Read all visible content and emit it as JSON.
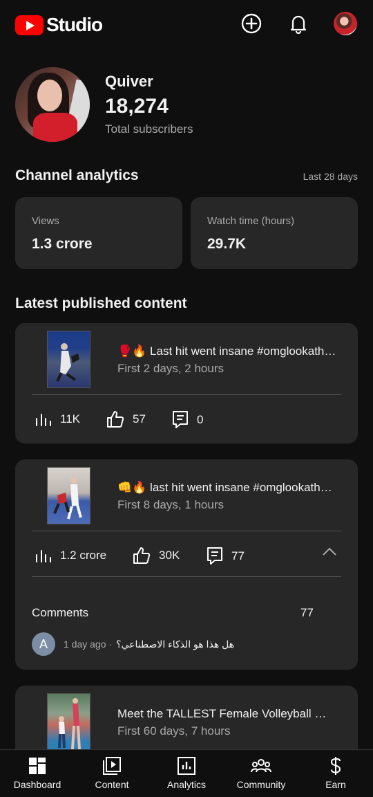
{
  "header": {
    "brand": "Studio",
    "icons": [
      "create-icon",
      "notifications-icon",
      "account-avatar"
    ]
  },
  "channel": {
    "name": "Quiver",
    "subscribers": "18,274",
    "subscribers_label": "Total subscribers"
  },
  "analytics": {
    "title": "Channel analytics",
    "range": "Last 28 days",
    "cards": [
      {
        "label": "Views",
        "value": "1.3 crore"
      },
      {
        "label": "Watch time (hours)",
        "value": "29.7K"
      }
    ]
  },
  "latest": {
    "title": "Latest published content",
    "items": [
      {
        "title": "🥊🔥 Last hit went insane #omglookath…",
        "subtitle": "First 2 days, 2 hours",
        "views": "11K",
        "likes": "57",
        "comments": "0"
      },
      {
        "title": "👊🔥 last hit went insane #omglookath…",
        "subtitle": "First 8 days, 1 hours",
        "views": "1.2 crore",
        "likes": "30K",
        "comments": "77",
        "comments_section": {
          "label": "Comments",
          "count": "77",
          "avatar_letter": "A",
          "time": "1 day ago ·",
          "text": "هل هذا هو الذكاء الاصطناعي؟"
        }
      },
      {
        "title": "Meet the TALLEST Female Volleyball …",
        "subtitle": "First 60 days, 7 hours"
      }
    ]
  },
  "nav": {
    "items": [
      {
        "label": "Dashboard",
        "icon": "dashboard-icon"
      },
      {
        "label": "Content",
        "icon": "content-icon"
      },
      {
        "label": "Analytics",
        "icon": "analytics-icon"
      },
      {
        "label": "Community",
        "icon": "community-icon"
      },
      {
        "label": "Earn",
        "icon": "earn-icon"
      }
    ]
  },
  "colors": {
    "background": "#0f0f0f",
    "card": "#272727",
    "brand_red": "#ff0000",
    "secondary_text": "#aaaaaa"
  }
}
